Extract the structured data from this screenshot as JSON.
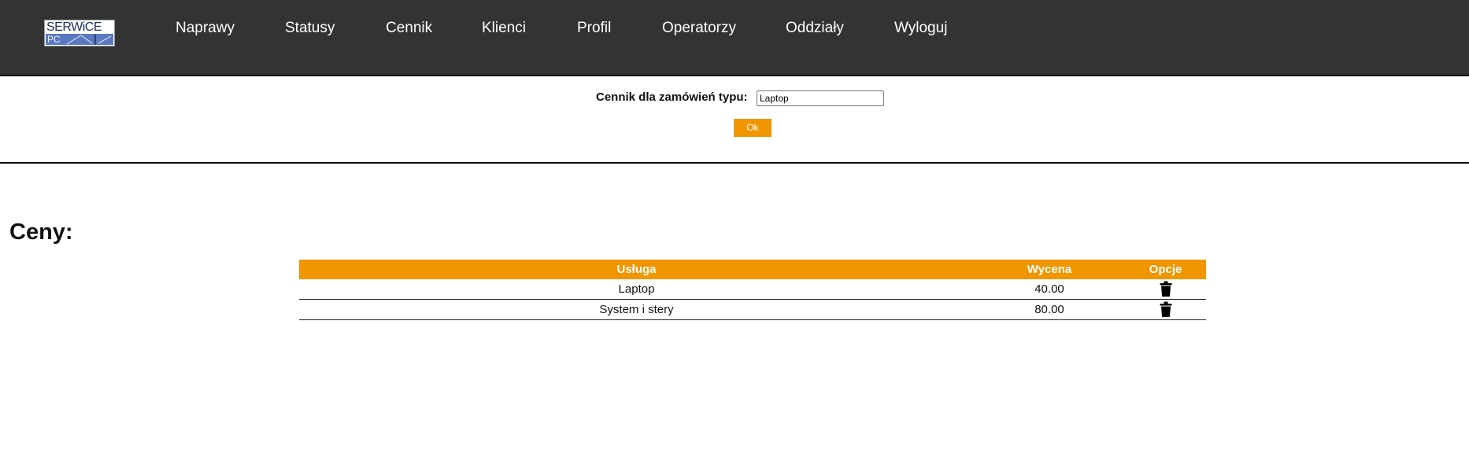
{
  "header": {
    "logo": {
      "line1": "SERWiCE",
      "line2": "PC"
    },
    "nav": [
      {
        "label": "Naprawy"
      },
      {
        "label": "Statusy"
      },
      {
        "label": "Cennik"
      },
      {
        "label": "Klienci"
      },
      {
        "label": "Profil"
      },
      {
        "label": "Operatorzy"
      },
      {
        "label": "Oddziały"
      },
      {
        "label": "Wyloguj"
      }
    ]
  },
  "form": {
    "label": "Cennik dla zamówień typu:",
    "value": "Laptop",
    "button": "Ok"
  },
  "prices": {
    "title": "Ceny:",
    "columns": [
      "Usługa",
      "Wycena",
      "Opcje"
    ],
    "rows": [
      {
        "service": "Laptop",
        "price": "40.00",
        "option_icon": "trash-icon"
      },
      {
        "service": "System i stery",
        "price": "80.00",
        "option_icon": "trash-icon"
      }
    ]
  },
  "colors": {
    "navbar": "#333333",
    "accent": "#ef9600"
  }
}
